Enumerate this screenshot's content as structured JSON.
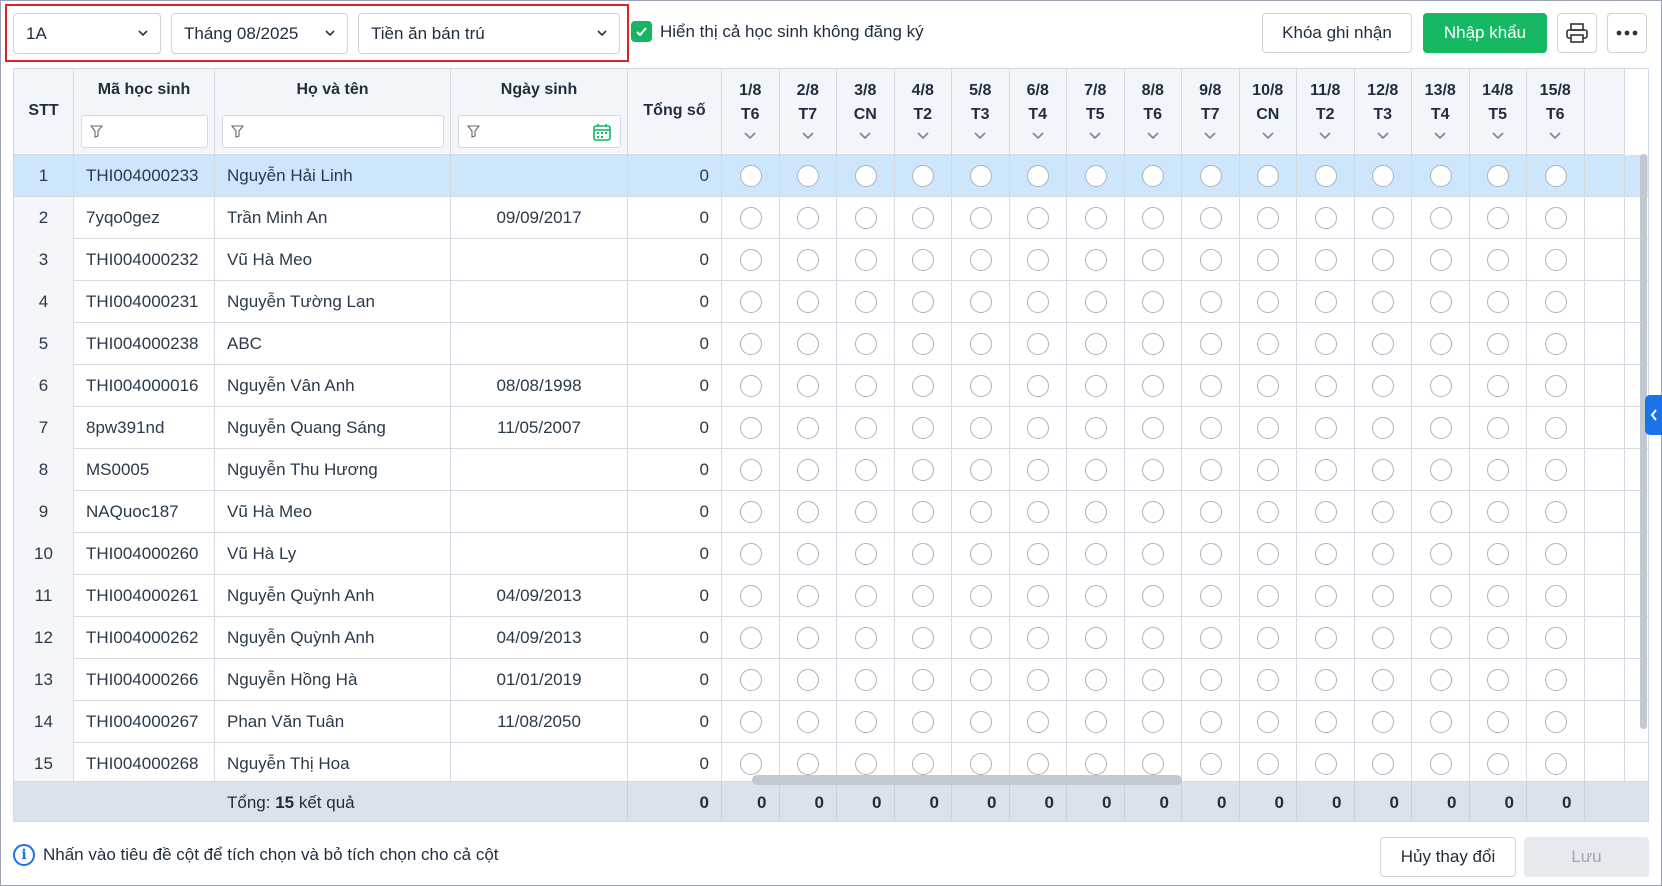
{
  "toolbar": {
    "class_value": "1A",
    "month_value": "Tháng 08/2025",
    "fee_value": "Tiền ăn bán trú",
    "show_unregistered_label": "Hiển thị cả học sinh không đăng ký",
    "show_unregistered_checked": true,
    "lock_label": "Khóa ghi nhận",
    "import_label": "Nhập khẩu",
    "print_icon": "print-icon",
    "more_icon": "more-icon"
  },
  "columns": {
    "stt": "STT",
    "code": "Mã học sinh",
    "name": "Họ và tên",
    "dob": "Ngày sinh",
    "total": "Tổng số"
  },
  "days": [
    {
      "date": "1/8",
      "dow": "T6"
    },
    {
      "date": "2/8",
      "dow": "T7"
    },
    {
      "date": "3/8",
      "dow": "CN"
    },
    {
      "date": "4/8",
      "dow": "T2"
    },
    {
      "date": "5/8",
      "dow": "T3"
    },
    {
      "date": "6/8",
      "dow": "T4"
    },
    {
      "date": "7/8",
      "dow": "T5"
    },
    {
      "date": "8/8",
      "dow": "T6"
    },
    {
      "date": "9/8",
      "dow": "T7"
    },
    {
      "date": "10/8",
      "dow": "CN"
    },
    {
      "date": "11/8",
      "dow": "T2"
    },
    {
      "date": "12/8",
      "dow": "T3"
    },
    {
      "date": "13/8",
      "dow": "T4"
    },
    {
      "date": "14/8",
      "dow": "T5"
    },
    {
      "date": "15/8",
      "dow": "T6"
    }
  ],
  "rows": [
    {
      "stt": "1",
      "code": "THI004000233",
      "name": "Nguyễn Hải Linh",
      "dob": "",
      "total": "0"
    },
    {
      "stt": "2",
      "code": "7yqo0gez",
      "name": "Trần Minh An",
      "dob": "09/09/2017",
      "total": "0"
    },
    {
      "stt": "3",
      "code": "THI004000232",
      "name": "Vũ Hà Meo",
      "dob": "",
      "total": "0"
    },
    {
      "stt": "4",
      "code": "THI004000231",
      "name": "Nguyễn Tường Lan",
      "dob": "",
      "total": "0"
    },
    {
      "stt": "5",
      "code": "THI004000238",
      "name": "ABC",
      "dob": "",
      "total": "0"
    },
    {
      "stt": "6",
      "code": "THI004000016",
      "name": "Nguyễn Vân Anh",
      "dob": "08/08/1998",
      "total": "0"
    },
    {
      "stt": "7",
      "code": "8pw391nd",
      "name": "Nguyễn Quang Sáng",
      "dob": "11/05/2007",
      "total": "0"
    },
    {
      "stt": "8",
      "code": "MS0005",
      "name": "Nguyễn Thu Hương",
      "dob": "",
      "total": "0"
    },
    {
      "stt": "9",
      "code": "NAQuoc187",
      "name": "Vũ Hà Meo",
      "dob": "",
      "total": "0"
    },
    {
      "stt": "10",
      "code": "THI004000260",
      "name": "Vũ Hà Ly",
      "dob": "",
      "total": "0"
    },
    {
      "stt": "11",
      "code": "THI004000261",
      "name": "Nguyễn Quỳnh Anh",
      "dob": "04/09/2013",
      "total": "0"
    },
    {
      "stt": "12",
      "code": "THI004000262",
      "name": "Nguyễn Quỳnh Anh",
      "dob": "04/09/2013",
      "total": "0"
    },
    {
      "stt": "13",
      "code": "THI004000266",
      "name": "Nguyễn Hồng Hà",
      "dob": "01/01/2019",
      "total": "0"
    },
    {
      "stt": "14",
      "code": "THI004000267",
      "name": "Phan Văn Tuân",
      "dob": "11/08/2050",
      "total": "0"
    },
    {
      "stt": "15",
      "code": "THI004000268",
      "name": "Nguyễn Thị Hoa",
      "dob": "",
      "total": "0"
    }
  ],
  "footer": {
    "summary_prefix": "Tổng: ",
    "summary_count": "15",
    "summary_suffix": " kết quả",
    "total": "0",
    "day_totals": [
      "0",
      "0",
      "0",
      "0",
      "0",
      "0",
      "0",
      "0",
      "0",
      "0",
      "0",
      "0",
      "0",
      "0",
      "0"
    ]
  },
  "bottom": {
    "hint": "Nhấn vào tiêu đề cột để tích chọn và bỏ tích chọn cho cả cột",
    "cancel_label": "Hủy thay đổi",
    "save_label": "Lưu"
  },
  "colors": {
    "accent_green": "#17b864",
    "selected_row": "#cde6fb",
    "info_blue": "#1a73e8",
    "highlight_red": "#e02424"
  }
}
